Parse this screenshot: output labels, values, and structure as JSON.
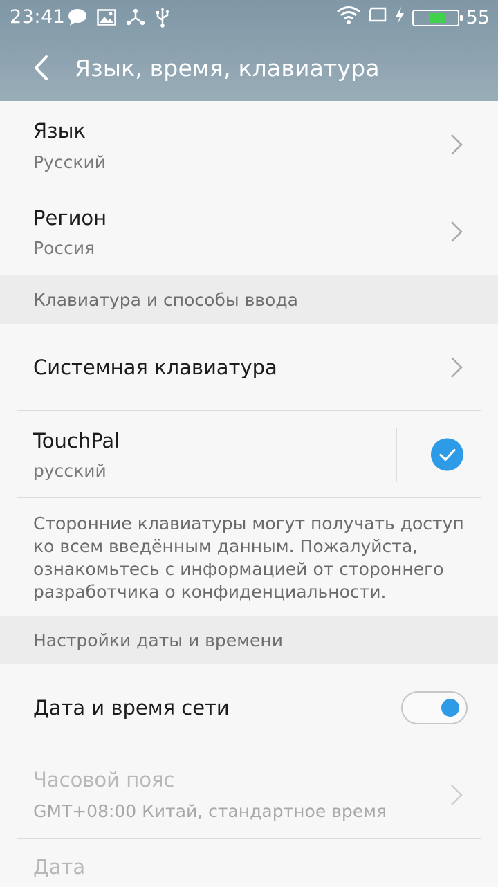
{
  "status_bar": {
    "time": "23:41",
    "battery_percent": "55",
    "battery_level": 0.55,
    "left_icons": [
      "chat-bubble-icon",
      "image-icon",
      "share-network-icon",
      "usb-icon"
    ],
    "right_icons": [
      "wifi-icon",
      "screen-icon",
      "charging-bolt-icon",
      "battery-icon"
    ]
  },
  "toolbar": {
    "title": "Язык, время, клавиатура",
    "back_icon": "chevron-left-icon"
  },
  "language": {
    "title": "Язык",
    "value": "Русский"
  },
  "region": {
    "title": "Регион",
    "value": "Россия"
  },
  "keyboard_section": {
    "header": "Клавиатура и способы ввода",
    "system_keyboard": "Системная клавиатура",
    "touchpal_title": "TouchPal",
    "touchpal_sub": "русский",
    "touchpal_checked": true,
    "note_lines": [
      "Сторонние клавиатуры могут получать доступ",
      "ко всем введённым данным. Пожалуйста,",
      "ознакомьтесь с информацией от стороннего",
      "разработчика о конфиденциальности."
    ]
  },
  "datetime_section": {
    "header": "Настройки даты и времени",
    "network_time": "Дата и время сети",
    "network_time_on": true,
    "timezone_title": "Часовой пояс",
    "timezone_value": "GMT+08:00 Китай, стандартное время",
    "date_title": "Дата"
  },
  "colors": {
    "accent": "#2d9be6",
    "battery_fill": "#3fd24a",
    "toolbar_gradient_top": "#7f97a6",
    "toolbar_gradient_bottom": "#9aaeb9"
  }
}
